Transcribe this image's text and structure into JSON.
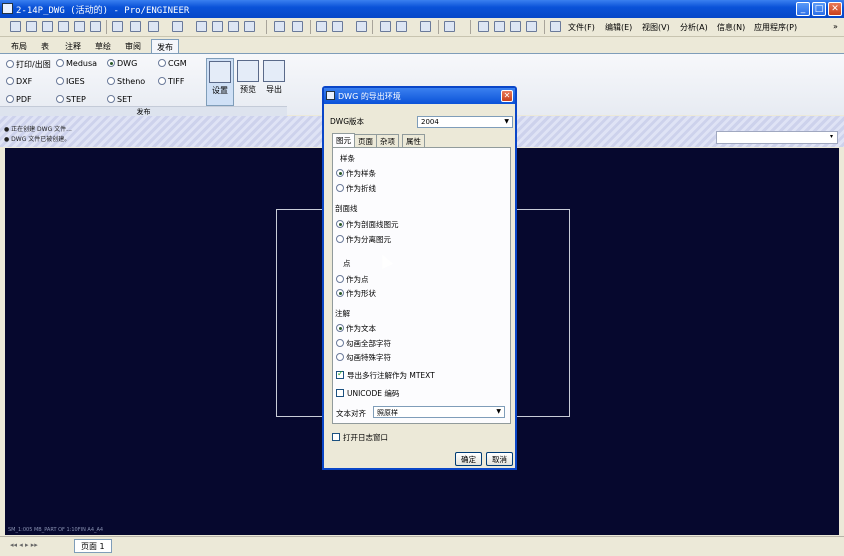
{
  "window": {
    "title": "2-14P_DWG (活动的) - Pro/ENGINEER"
  },
  "menus": [
    "文件(F)",
    "编辑(E)",
    "视图(V)",
    "分析(A)",
    "信息(N)",
    "应用程序(P)"
  ],
  "ribbon": {
    "tabs": [
      "布局",
      "表",
      "注释",
      "草绘",
      "审阅",
      "发布"
    ],
    "active_tab": "发布",
    "formats": [
      {
        "label": "打印/出图",
        "selected": false
      },
      {
        "label": "Medusa",
        "selected": false
      },
      {
        "label": "DWG",
        "selected": true
      },
      {
        "label": "CGM",
        "selected": false
      },
      {
        "label": "DXF",
        "selected": false
      },
      {
        "label": "IGES",
        "selected": false
      },
      {
        "label": "Stheno",
        "selected": false
      },
      {
        "label": "TIFF",
        "selected": false
      },
      {
        "label": "PDF",
        "selected": false
      },
      {
        "label": "STEP",
        "selected": false
      },
      {
        "label": "SET",
        "selected": false
      }
    ],
    "buttons": [
      "设置",
      "预览",
      "导出"
    ],
    "group_label": "发布"
  },
  "messages": [
    "● 正在创建 DWG 文件...",
    "● DWG 文件已被创建。"
  ],
  "status": {
    "text": "SM_1:005   MB_PART  OF 1:10FIN  A4_A4"
  },
  "bottom": {
    "page_tab": "页面 1"
  },
  "dialog": {
    "title": "DWG 的导出环境",
    "version_label": "DWG版本",
    "version_value": "2004",
    "tabs": [
      "图元",
      "页面",
      "杂项",
      "属性"
    ],
    "active_tab": "图元",
    "spline_title": "样条",
    "spline_options": [
      {
        "label": "作为样条",
        "selected": true
      },
      {
        "label": "作为折线",
        "selected": false
      }
    ],
    "hatch_title": "剖面线",
    "hatch_options": [
      {
        "label": "作为剖面线图元",
        "selected": true
      },
      {
        "label": "作为分离图元",
        "selected": false
      }
    ],
    "point_title": "点",
    "point_options": [
      {
        "label": "作为点",
        "selected": false
      },
      {
        "label": "作为形状",
        "selected": true
      }
    ],
    "note_title": "注解",
    "note_options": [
      {
        "label": "作为文本",
        "selected": true
      },
      {
        "label": "勾画全部字符",
        "selected": false
      },
      {
        "label": "勾画特殊字符",
        "selected": false
      }
    ],
    "mtext_label": "导出多行注解作为 MTEXT",
    "mtext_checked": true,
    "unicode_label": "UNICODE 编码",
    "unicode_checked": false,
    "align_label": "文本对齐",
    "align_value": "照原样",
    "log_label": "打开日志窗口",
    "log_checked": false,
    "ok_label": "确定",
    "cancel_label": "取消"
  }
}
